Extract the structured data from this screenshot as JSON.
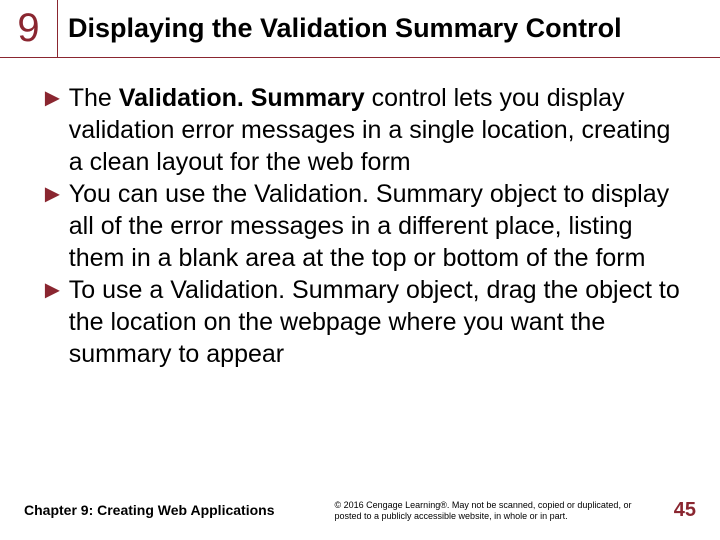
{
  "header": {
    "chapter_number": "9",
    "title": "Displaying the Validation Summary Control"
  },
  "bullets": [
    {
      "pre": "The ",
      "bold": "Validation. Summary",
      "post": " control lets you display validation error messages in a single location, creating a clean layout for the web form"
    },
    {
      "pre": "",
      "bold": "",
      "post": "You can use the Validation. Summary object to display all of the error messages in a different place, listing them in a blank area at the top or bottom of the form"
    },
    {
      "pre": "",
      "bold": "",
      "post": "To use a Validation. Summary object, drag the object to the location on the webpage where you want the summary to appear"
    }
  ],
  "footer": {
    "left": "Chapter 9: Creating Web Applications",
    "center": "© 2016 Cengage Learning®. May not be scanned, copied or duplicated, or posted to a publicly accessible website, in whole or in part.",
    "page": "45"
  }
}
